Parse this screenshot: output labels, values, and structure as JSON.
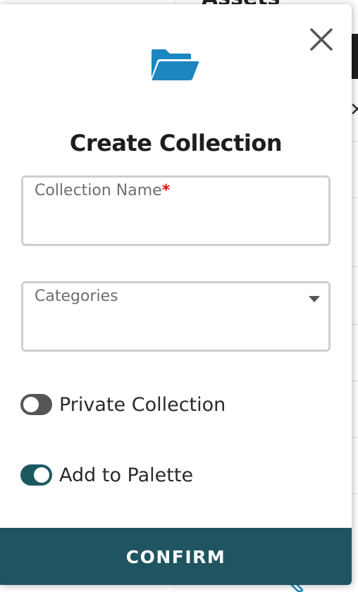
{
  "dialog": {
    "title": "Create Collection",
    "icon": "folder-open-icon",
    "close_icon": "close-icon"
  },
  "background": {
    "title_fragment": "Assets"
  },
  "form": {
    "collection_name": {
      "label": "Collection Name",
      "required_marker": "*",
      "value": ""
    },
    "categories": {
      "label": "Categories",
      "value": ""
    },
    "private_collection": {
      "label": "Private Collection",
      "checked": false
    },
    "add_to_palette": {
      "label": "Add to Palette",
      "checked": true
    }
  },
  "actions": {
    "confirm_label": "CONFIRM"
  },
  "colors": {
    "accent": "#1f5560",
    "folder_icon": "#1b86bf",
    "required": "#e01010",
    "toggle_off": "#555555"
  }
}
